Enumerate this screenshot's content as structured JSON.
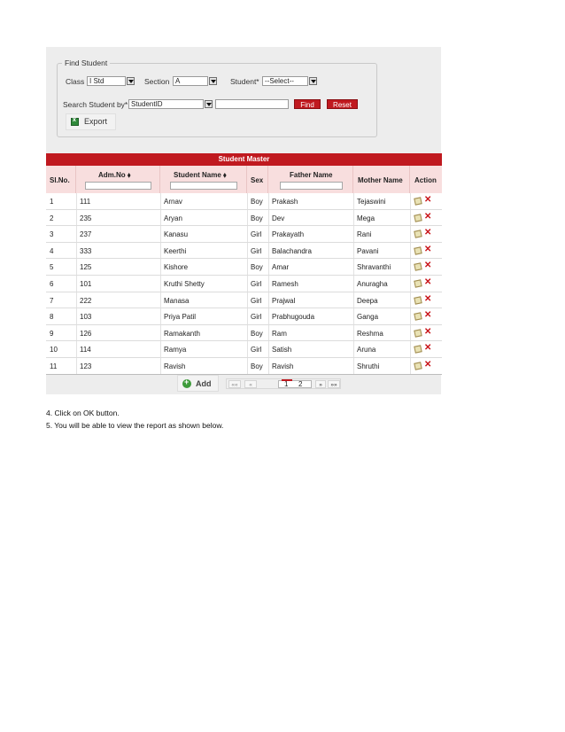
{
  "find_student": {
    "legend": "Find Student",
    "class_label": "Class",
    "class_value": "I Std",
    "section_label": "Section",
    "section_value": "A",
    "student_label": "Student*",
    "student_value": "--Select--",
    "search_by_label": "Search Student by*",
    "search_by_value": "StudentID",
    "search_input": "",
    "find_label": "Find",
    "reset_label": "Reset",
    "export_label": "Export"
  },
  "table": {
    "title": "Student Master",
    "headers": {
      "slno": "Sl.No.",
      "admno": "Adm.No ⬧",
      "name": "Student Name ⬧",
      "sex": "Sex",
      "father": "Father Name",
      "mother": "Mother Name",
      "action": "Action"
    },
    "rows": [
      [
        "1",
        "111",
        "Arnav",
        "Boy",
        "Prakash",
        "Tejaswini"
      ],
      [
        "2",
        "235",
        "Aryan",
        "Boy",
        "Dev",
        "Mega"
      ],
      [
        "3",
        "237",
        "Kanasu",
        "Girl",
        "Prakayath",
        "Rani"
      ],
      [
        "4",
        "333",
        "Keerthi",
        "Girl",
        "Balachandra",
        "Pavani"
      ],
      [
        "5",
        "125",
        "Kishore",
        "Boy",
        "Amar",
        "Shravanthi"
      ],
      [
        "6",
        "101",
        "Kruthi Shetty",
        "Girl",
        "Ramesh",
        "Anuragha"
      ],
      [
        "7",
        "222",
        "Manasa",
        "Girl",
        "Prajwal",
        "Deepa"
      ],
      [
        "8",
        "103",
        "Priya Patil",
        "Girl",
        "Prabhugouda",
        "Ganga"
      ],
      [
        "9",
        "126",
        "Ramakanth",
        "Boy",
        "Ram",
        "Reshma"
      ],
      [
        "10",
        "114",
        "Ramya",
        "Girl",
        "Satish",
        "Aruna"
      ],
      [
        "11",
        "123",
        "Ravish",
        "Boy",
        "Ravish",
        "Shruthi"
      ]
    ]
  },
  "footer": {
    "add_label": "Add",
    "pager": {
      "first": "««",
      "prev": "«",
      "page1": "1",
      "page2": "2",
      "next": "»",
      "last": "»»"
    }
  },
  "document": {
    "step4": "4. Click on OK button.",
    "step5": "5. You will be able to view the report as shown below."
  },
  "colors": {
    "accent": "#c0191f",
    "header_bg": "#f8dede",
    "panel_bg": "#ededed"
  }
}
